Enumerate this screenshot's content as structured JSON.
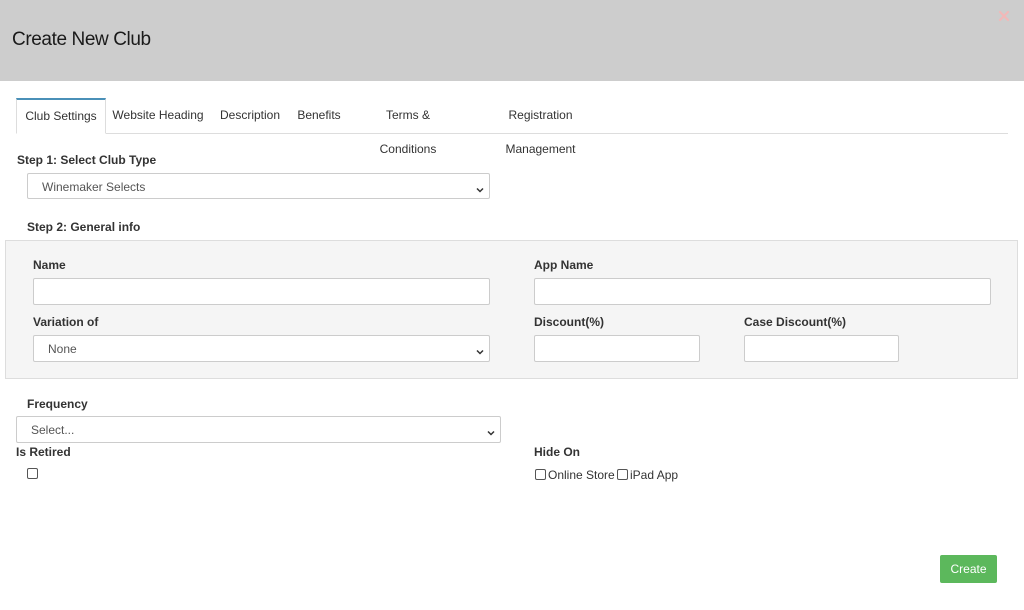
{
  "modal": {
    "title": "Create New Club",
    "close_icon": "close-icon",
    "close_color": "#f2b8b8"
  },
  "tabs": [
    {
      "label": "Club Settings",
      "active": true
    },
    {
      "label": "Website Heading",
      "active": false
    },
    {
      "label": "Description",
      "active": false
    },
    {
      "label": "Benefits",
      "active": false
    },
    {
      "label": "Terms & Conditions",
      "active": false
    },
    {
      "label": "Registration Management",
      "active": false
    }
  ],
  "step1": {
    "label": "Step 1: Select Club Type",
    "club_type_value": "Winemaker Selects"
  },
  "step2": {
    "label": "Step 2: General info",
    "name_label": "Name",
    "name_value": "",
    "app_name_label": "App Name",
    "app_name_value": "",
    "variation_label": "Variation of",
    "variation_value": "None",
    "discount_label": "Discount(%)",
    "discount_value": "",
    "case_discount_label": "Case Discount(%)",
    "case_discount_value": ""
  },
  "frequency": {
    "label": "Frequency",
    "value": "Select..."
  },
  "is_retired": {
    "label": "Is Retired",
    "checked": false
  },
  "hide_on": {
    "label": "Hide On",
    "online_store_label": "Online Store",
    "online_store_checked": false,
    "ipad_app_label": "iPad App",
    "ipad_app_checked": false
  },
  "create_button": {
    "label": "Create",
    "color": "#5cb85c"
  }
}
